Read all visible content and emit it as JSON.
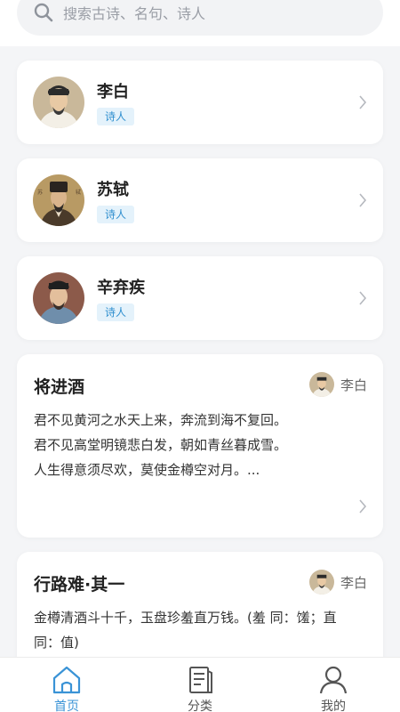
{
  "search": {
    "placeholder": "搜索古诗、名句、诗人",
    "icon": "search-icon"
  },
  "poets": [
    {
      "name": "李白",
      "tag": "诗人",
      "avatar": "li-bai-portrait"
    },
    {
      "name": "苏轼",
      "tag": "诗人",
      "avatar": "su-shi-portrait"
    },
    {
      "name": "辛弃疾",
      "tag": "诗人",
      "avatar": "xin-qiji-portrait"
    }
  ],
  "poems": [
    {
      "title": "将进酒",
      "author": "李白",
      "lines": [
        "君不见黄河之水天上来，奔流到海不复回。",
        "君不见高堂明镜悲白发，朝如青丝暮成雪。",
        "人生得意须尽欢，莫使金樽空对月。..."
      ]
    },
    {
      "title": "行路难·其一",
      "author": "李白",
      "lines": [
        "金樽清酒斗十千，玉盘珍羞直万钱。(羞 同：馐；直",
        "同：值)"
      ]
    }
  ],
  "tabs": [
    {
      "label": "首页",
      "icon": "home-icon",
      "active": true
    },
    {
      "label": "分类",
      "icon": "book-icon",
      "active": false
    },
    {
      "label": "我的",
      "icon": "user-icon",
      "active": false
    }
  ],
  "colors": {
    "accent": "#3a93d6",
    "tag_bg": "#e4f2fb",
    "tag_text": "#2f8fcf",
    "page_bg": "#f4f5f7"
  }
}
